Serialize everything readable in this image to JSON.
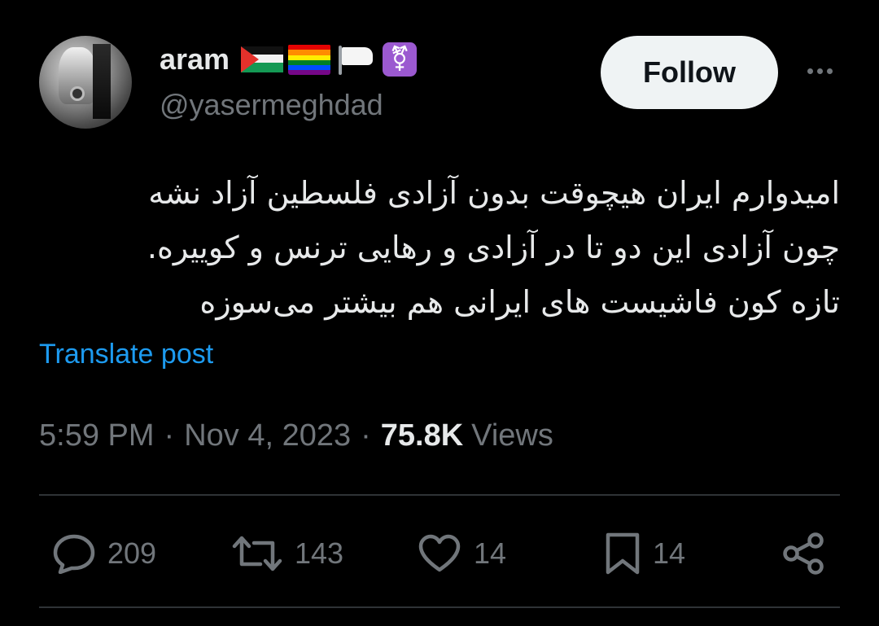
{
  "user": {
    "display_name": "aram",
    "handle": "@yasermeghdad",
    "name_badges": [
      "palestine-flag-icon",
      "rainbow-flag-icon",
      "white-flag-icon",
      "transgender-symbol-icon"
    ],
    "trans_symbol": "⚧"
  },
  "header": {
    "follow_label": "Follow",
    "more_icon": "more-horizontal-icon"
  },
  "tweet": {
    "lines": [
      "امیدوارم ایران هیچوقت بدون آزادی فلسطین آزاد نشه",
      "چون آزادی این دو تا در آزادی و رهایی ترنس و کوییره.",
      "تازه کون فاشیست های ایرانی هم بیشتر می‌سوزه"
    ],
    "translate_label": "Translate post"
  },
  "meta": {
    "time": "5:59 PM",
    "separator": "·",
    "date": "Nov 4, 2023",
    "views_count": "75.8K",
    "views_label": "Views"
  },
  "actions": {
    "replies": "209",
    "reposts": "143",
    "likes": "14",
    "bookmarks": "14"
  },
  "colors": {
    "background": "#000000",
    "text": "#e7e9ea",
    "secondary": "#71767b",
    "link": "#1d9bf0",
    "divider": "#2f3336",
    "follow_bg": "#eff3f4"
  }
}
